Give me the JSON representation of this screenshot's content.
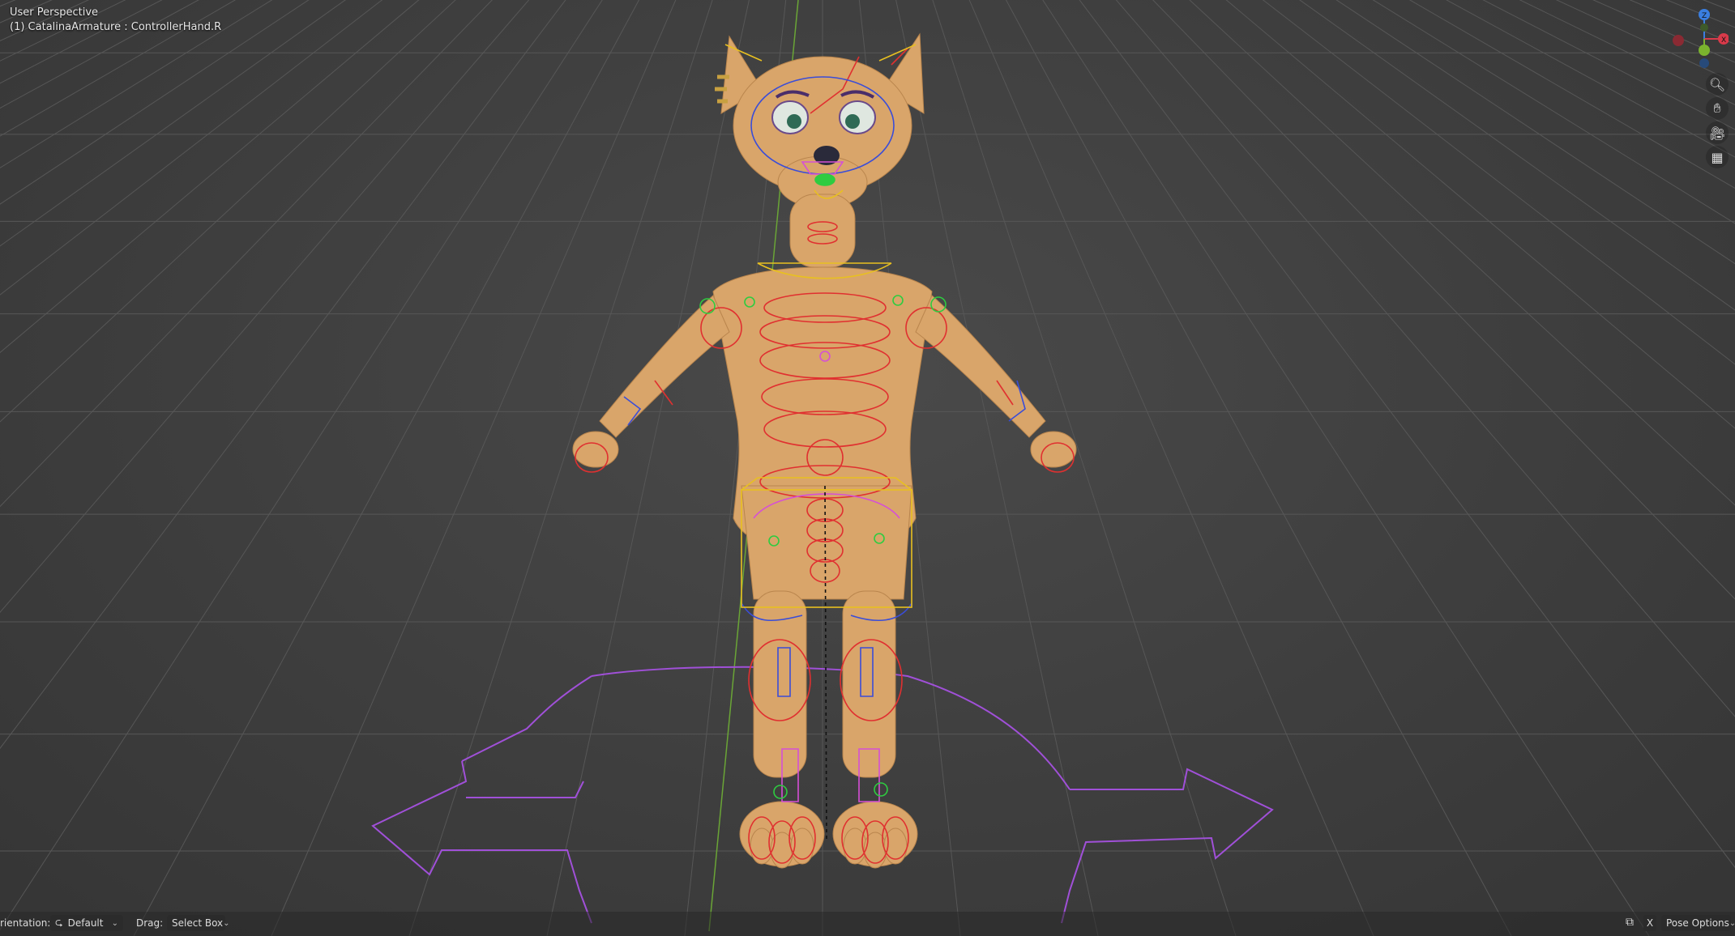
{
  "viewport": {
    "perspective_label": "User Perspective",
    "object_label": "(1) CatalinaArmature : ControllerHand.R"
  },
  "gizmo": {
    "z_label": "Z",
    "x_label": "X"
  },
  "nav": {
    "zoom_icon": "zoom-icon",
    "pan_icon": "hand-icon",
    "camera_icon": "camera-icon",
    "ortho_icon": "grid-icon"
  },
  "bottom_bar": {
    "orientation_label": "rientation:",
    "orientation_value": "Default",
    "drag_label": "Drag:",
    "drag_value": "Select Box",
    "x_toggle": "X",
    "pose_options": "Pose Options"
  },
  "colors": {
    "background": "#3d3d3d",
    "skin": "#d9a56a",
    "bone_red": "#e03030",
    "bone_blue": "#3a4dd8",
    "bone_magenta": "#d64fd6",
    "bone_green": "#2ecc40",
    "bone_yellow": "#e8c020",
    "arrow_purple": "#a050d8",
    "axis_x": "#d93a4a",
    "axis_y": "#7ab32e",
    "axis_z": "#3a7ee0"
  }
}
